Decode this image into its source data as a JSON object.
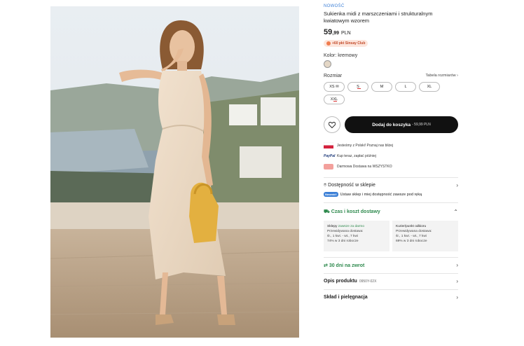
{
  "product": {
    "tag": "NOWOŚĆ",
    "title": "Sukienka midi z marszczeniami i strukturalnym kwiatowym wzorem",
    "price_main": "59",
    "price_cents": ",99",
    "price_currency": "PLN",
    "club_badge": "+60 pkt Sinsay Club",
    "color_label": "Kolor: kremowy",
    "size_label": "Rozmiar",
    "size_guide": "Tabela rozmiarów",
    "sizes": [
      "XS",
      "S",
      "M",
      "L",
      "XL",
      "XXL"
    ],
    "add_to_cart": "Dodaj do koszyka",
    "add_to_cart_price": "- 59,99 PLN"
  },
  "benefits": [
    {
      "icon": "poland-flag-icon",
      "text": "Jesteśmy z Polski! Poznaj nas bliżej"
    },
    {
      "icon": "paypal-icon",
      "text": "Kup teraz, zapłać później"
    },
    {
      "icon": "delivery-truck-icon",
      "text": "Darmowa Dostawa na WSZYSTKO"
    }
  ],
  "paypal_logo": "PayPal",
  "availability": {
    "title": "Dostępność w sklepie",
    "badge": "Nowość!",
    "text": "Ustaw sklep i miej dostępność zawsze pod ręką"
  },
  "delivery": {
    "title": "Czas i koszt dostawy",
    "stores": {
      "head": "Sklepy",
      "free": "zawsze za darmo",
      "line1": "Przewidywana dostawa:",
      "line2": "śr., 1 kwi. - wt., 7 kwi",
      "line3": "74% w 3 dni robocze"
    },
    "courier": {
      "head": "Kurier/punkt odbioru",
      "line1": "Przewidywana dostawa:",
      "line2": "śr., 1 kwi. - wt., 7 kwi",
      "line3": "69% w 3 dni robocze"
    }
  },
  "returns": {
    "title": "30 dni na zwrot"
  },
  "description": {
    "title": "Opis produktu",
    "code": "0950Y-02X"
  },
  "care": {
    "title": "Skład i pielęgnacja"
  },
  "colors": {
    "green": "#2f8a4e",
    "blue": "#3b7fd6",
    "cta": "#111111"
  }
}
